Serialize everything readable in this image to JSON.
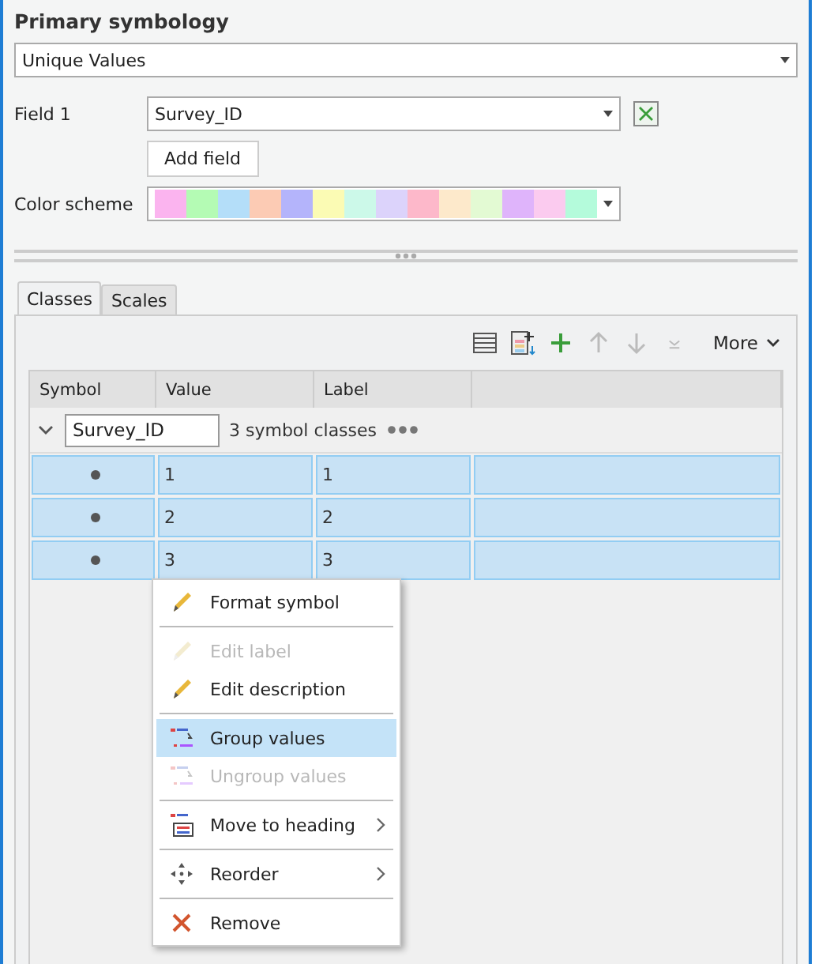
{
  "title": "Primary symbology",
  "renderer": {
    "value": "Unique Values"
  },
  "field1": {
    "label": "Field 1",
    "value": "Survey_ID"
  },
  "add_field": "Add field",
  "color_scheme": {
    "label": "Color scheme",
    "swatches": [
      {
        "color": "#fbb4ef"
      },
      {
        "color": "#b4fbb4"
      },
      {
        "color": "#b4def9"
      },
      {
        "color": "#fccbb4"
      },
      {
        "color": "#b4b4fb"
      },
      {
        "color": "#fbfbb4"
      },
      {
        "color": "#ccf9e9"
      },
      {
        "color": "#dcd3fb"
      },
      {
        "color": "#fdb8ca"
      },
      {
        "color": "#fde9cb"
      },
      {
        "color": "#e3fad3"
      },
      {
        "color": "#dfb4fb"
      },
      {
        "color": "#fbcbef"
      },
      {
        "color": "#b4fbdb"
      }
    ]
  },
  "tabs": [
    {
      "label": "Classes",
      "selected": true
    },
    {
      "label": "Scales",
      "selected": false
    }
  ],
  "toolbar": {
    "tools": [
      {
        "disabled": false
      },
      {
        "disabled": false
      },
      {
        "disabled": false
      },
      {
        "disabled": true
      },
      {
        "disabled": true
      },
      {
        "disabled": true
      }
    ],
    "more": "More"
  },
  "table": {
    "columns": [
      "Symbol",
      "Value",
      "Label"
    ],
    "group": {
      "expanded": true,
      "name": "Survey_ID",
      "count": "3 symbol classes"
    },
    "rows": [
      {
        "value": "1",
        "label": "1",
        "selected": true
      },
      {
        "value": "2",
        "label": "2",
        "selected": true
      },
      {
        "value": "3",
        "label": "3",
        "selected": true
      }
    ]
  },
  "context_menu": [
    [
      {
        "label": "Format symbol",
        "disabled": false,
        "selected": false,
        "submenu": false
      }
    ],
    [
      {
        "label": "Edit label",
        "disabled": true,
        "selected": false,
        "submenu": false
      },
      {
        "label": "Edit description",
        "disabled": false,
        "selected": false,
        "submenu": false
      }
    ],
    [
      {
        "label": "Group values",
        "disabled": false,
        "selected": true,
        "submenu": false
      },
      {
        "label": "Ungroup values",
        "disabled": true,
        "selected": false,
        "submenu": false
      }
    ],
    [
      {
        "label": "Move to heading",
        "disabled": false,
        "selected": false,
        "submenu": true
      }
    ],
    [
      {
        "label": "Reorder",
        "disabled": false,
        "selected": false,
        "submenu": true
      }
    ],
    [
      {
        "label": "Remove",
        "disabled": false,
        "selected": false,
        "submenu": false
      }
    ]
  ]
}
